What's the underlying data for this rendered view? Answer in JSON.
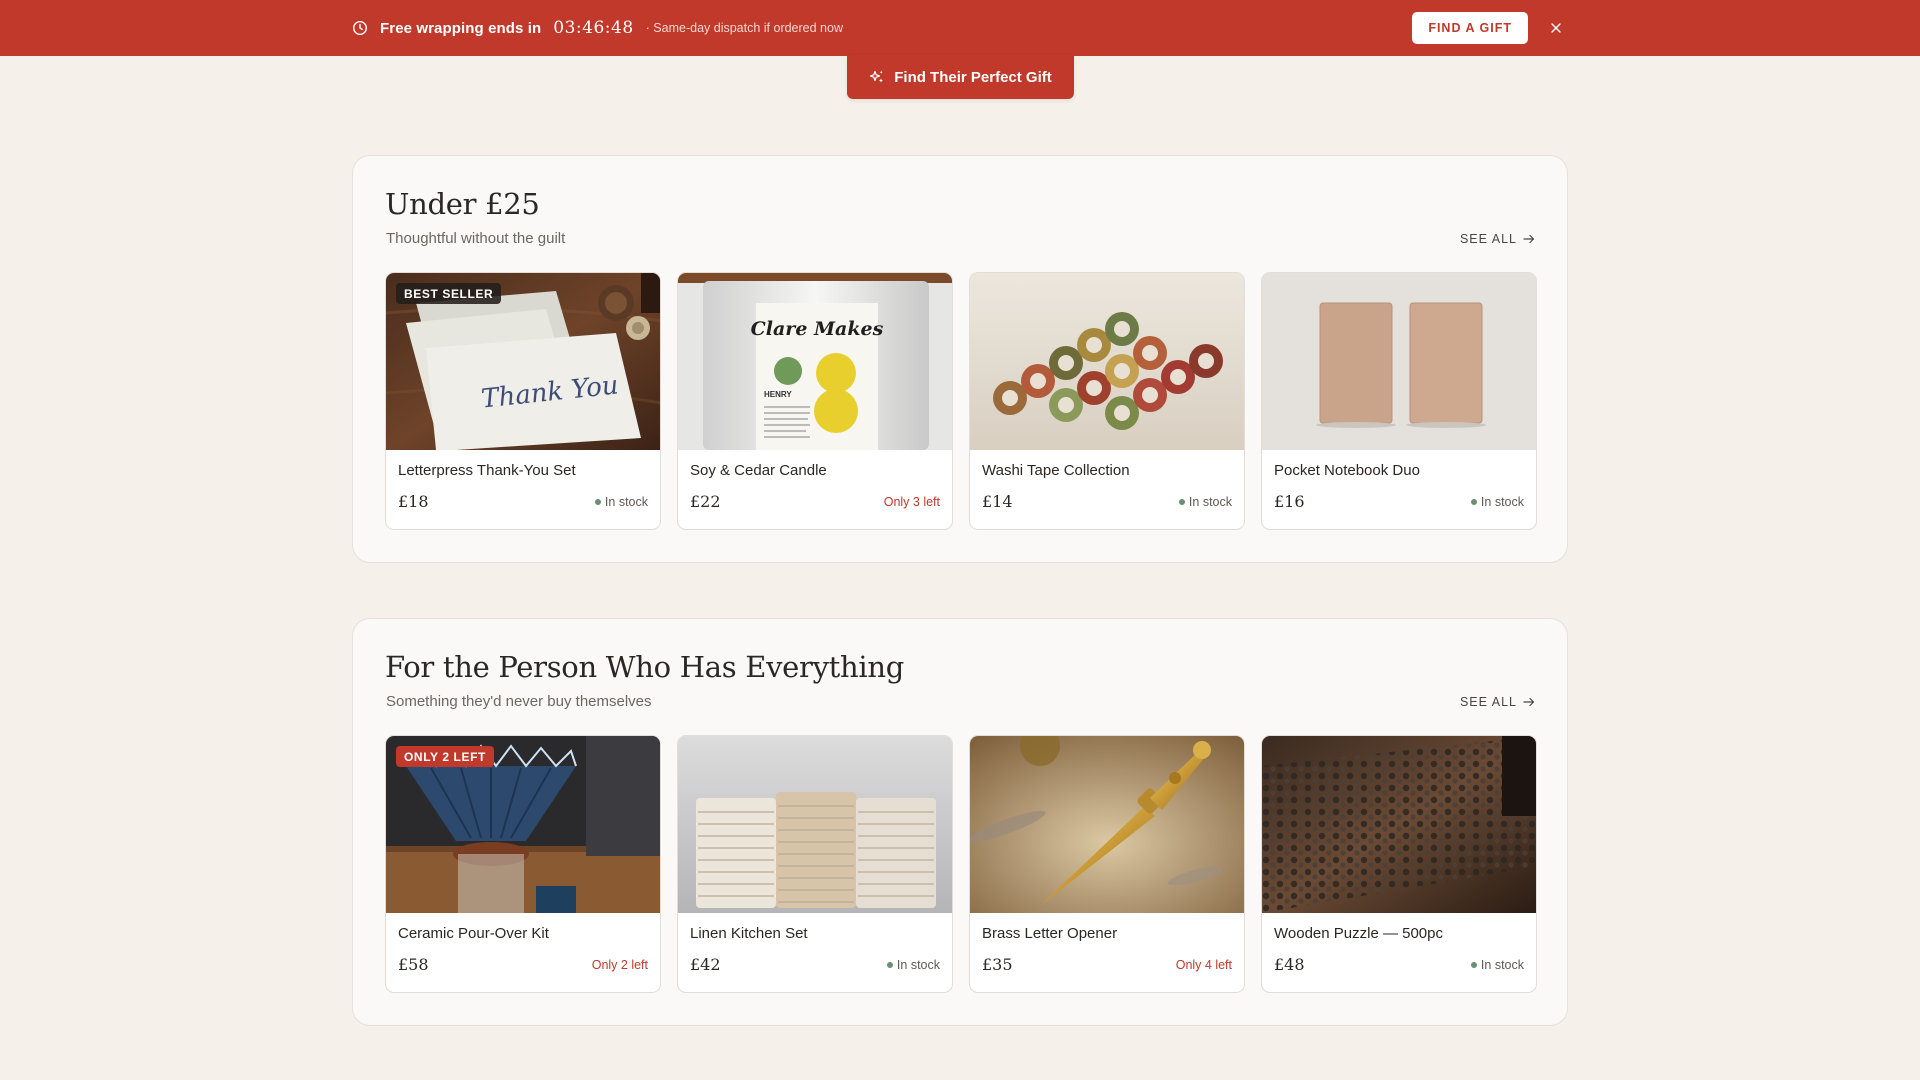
{
  "promo": {
    "text": "Free wrapping ends in",
    "timer": "03:46:48",
    "sub": "Same-day dispatch if ordered now",
    "button": "FIND A GIFT"
  },
  "cta": {
    "label": "Find Their Perfect Gift"
  },
  "colors": {
    "accent": "#c0392b",
    "background": "#f5f0ea",
    "in_stock_dot": "#6b8f71"
  },
  "sections": [
    {
      "title": "Under £25",
      "subtitle": "Thoughtful without the guilt",
      "see_all": "SEE ALL",
      "products": [
        {
          "name": "Letterpress Thank-You Set",
          "price": "£18",
          "stock": "In stock",
          "badge": "BEST SELLER"
        },
        {
          "name": "Soy & Cedar Candle",
          "price": "£22",
          "stock": "Only 3 left",
          "candle_brand": "Clare Makes",
          "candle_variant": "HENRY"
        },
        {
          "name": "Washi Tape Collection",
          "price": "£14",
          "stock": "In stock"
        },
        {
          "name": "Pocket Notebook Duo",
          "price": "£16",
          "stock": "In stock"
        }
      ]
    },
    {
      "title": "For the Person Who Has Everything",
      "subtitle": "Something they'd never buy themselves",
      "see_all": "SEE ALL",
      "products": [
        {
          "name": "Ceramic Pour-Over Kit",
          "price": "£58",
          "stock": "Only 2 left",
          "badge": "ONLY 2 LEFT"
        },
        {
          "name": "Linen Kitchen Set",
          "price": "£42",
          "stock": "In stock"
        },
        {
          "name": "Brass Letter Opener",
          "price": "£35",
          "stock": "Only 4 left"
        },
        {
          "name": "Wooden Puzzle — 500pc",
          "price": "£48",
          "stock": "In stock"
        }
      ]
    }
  ]
}
